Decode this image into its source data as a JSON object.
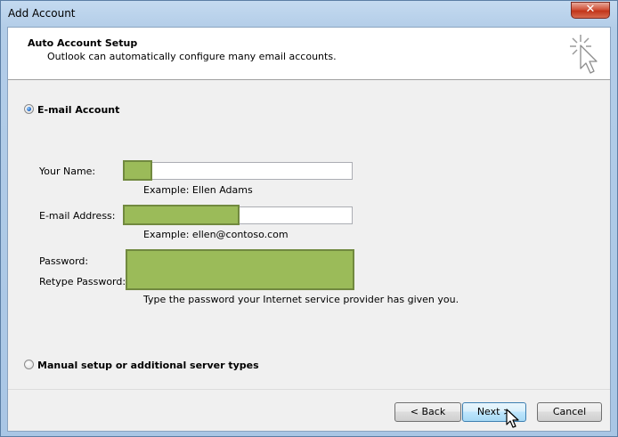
{
  "window": {
    "title": "Add Account",
    "close_glyph": "✕"
  },
  "header": {
    "title": "Auto Account Setup",
    "subtitle": "Outlook can automatically configure many email accounts.",
    "icon": "wizard-sparkle-cursor-icon"
  },
  "email_account_option": {
    "label": "E-mail Account",
    "selected": true
  },
  "fields": {
    "your_name": {
      "label": "Your Name:",
      "example": "Example: Ellen Adams",
      "value_redacted": true
    },
    "email": {
      "label": "E-mail Address:",
      "example": "Example: ellen@contoso.com",
      "value_redacted": true
    },
    "password": {
      "label": "Password:",
      "value_redacted": true
    },
    "retype_password": {
      "label": "Retype Password:",
      "value_redacted": true
    },
    "password_hint": "Type the password your Internet service provider has given you."
  },
  "manual_option": {
    "label": "Manual setup or additional server types",
    "selected": false
  },
  "buttons": {
    "back": "< Back",
    "next": "Next >",
    "cancel": "Cancel"
  },
  "colors": {
    "redaction_fill": "#9bbb59",
    "redaction_border": "#71893f",
    "close_button": "#c2351a"
  }
}
